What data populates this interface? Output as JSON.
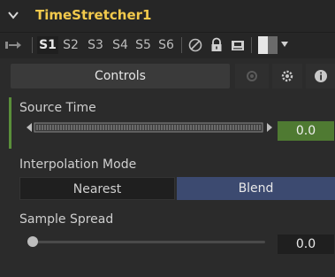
{
  "tool": {
    "title": "TimeStretcher1"
  },
  "toolbar": {
    "slots": [
      "S1",
      "S2",
      "S3",
      "S4",
      "S5",
      "S6"
    ],
    "active_slot": "S1"
  },
  "tabs": {
    "controls_label": "Controls",
    "icons": [
      "modifiers-icon",
      "settings-gear-icon",
      "info-icon"
    ]
  },
  "controls": {
    "source_time": {
      "label": "Source Time",
      "value": "0.0"
    },
    "interpolation": {
      "label": "Interpolation Mode",
      "options": [
        "Nearest",
        "Blend"
      ],
      "selected": "Blend"
    },
    "sample_spread": {
      "label": "Sample Spread",
      "value": "0.0",
      "level": 0
    }
  },
  "colors": {
    "title": "#f2c94c",
    "green_value": "#4f7a32",
    "blend_selected": "#3c4a70"
  }
}
